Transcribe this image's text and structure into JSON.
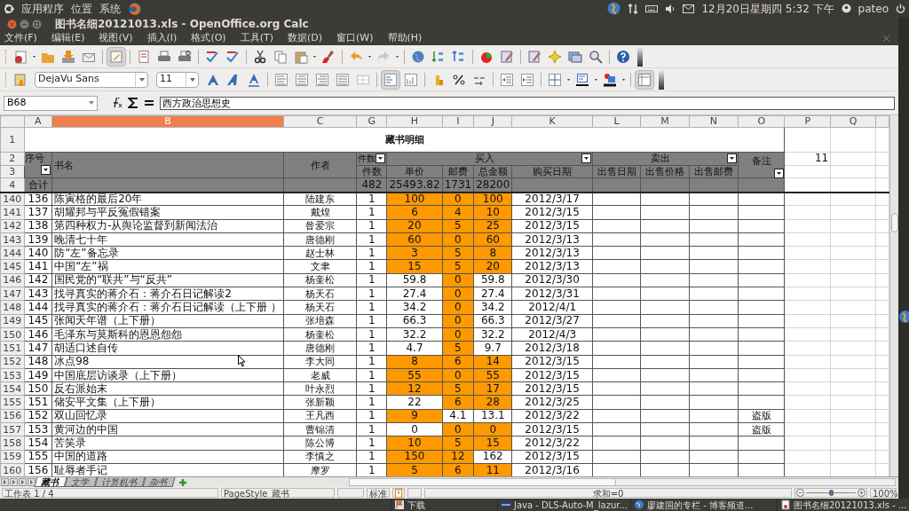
{
  "top_panel": {
    "menus": [
      "应用程序",
      "位置",
      "系统"
    ],
    "clock": "12月20日星期四 5:32 下午",
    "user": "pateo"
  },
  "window": {
    "title": "图书名细20121013.xls - OpenOffice.org Calc"
  },
  "menu": [
    "文件(F)",
    "编辑(E)",
    "视图(V)",
    "插入(I)",
    "格式(O)",
    "工具(T)",
    "数据(D)",
    "窗口(W)",
    "帮助(H)"
  ],
  "formatting": {
    "font": "DejaVu Sans",
    "size": "11"
  },
  "formula_bar": {
    "name_box": "B68",
    "formula": "西方政治思想史"
  },
  "sheet": {
    "columns": [
      {
        "label": "A",
        "selected": false
      },
      {
        "label": "B",
        "selected": true
      },
      {
        "label": "C",
        "selected": false
      },
      {
        "label": "G",
        "selected": false
      },
      {
        "label": "H",
        "selected": false
      },
      {
        "label": "I",
        "selected": false
      },
      {
        "label": "J",
        "selected": false
      },
      {
        "label": "K",
        "selected": false
      },
      {
        "label": "L",
        "selected": false
      },
      {
        "label": "M",
        "selected": false
      },
      {
        "label": "N",
        "selected": false
      },
      {
        "label": "O",
        "selected": false
      },
      {
        "label": "P",
        "selected": false
      },
      {
        "label": "Q",
        "selected": false
      }
    ],
    "header_rows": [
      "1",
      "2",
      "3",
      "4"
    ],
    "title": "藏书明细",
    "headers": {
      "no": "序号",
      "title": "书名",
      "author": "作者",
      "count_group": "件数",
      "buy": "买入",
      "sell": "卖出",
      "note": "备注",
      "count": "件数",
      "price": "单价",
      "postage": "邮费",
      "total": "总金额",
      "buy_date": "购买日期",
      "sell_date": "出售日期",
      "sell_price": "出售价格",
      "sell_postage": "出售邮费"
    },
    "totals": {
      "label": "合计",
      "count": "482",
      "price": "25493.82",
      "postage": "1731",
      "total": "28200"
    },
    "p2": "11",
    "rows": [
      {
        "row": "140",
        "no": "136",
        "title": "陈寅格的最后20年",
        "author": "陆建东",
        "count": "1",
        "price": "100",
        "postage": "0",
        "total": "100",
        "date": "2012/3/17",
        "highlight": {
          "price": true,
          "postage": true,
          "total": true
        }
      },
      {
        "row": "141",
        "no": "137",
        "title": "胡耀邦与平反冤假错案",
        "author": "戴煌",
        "count": "1",
        "price": "6",
        "postage": "4",
        "total": "10",
        "date": "2012/3/15",
        "highlight": {
          "price": true,
          "postage": true,
          "total": true
        }
      },
      {
        "row": "142",
        "no": "138",
        "title": "第四种权力-从舆论监督到新闻法治",
        "author": "昝爱宗",
        "count": "1",
        "price": "20",
        "postage": "5",
        "total": "25",
        "date": "2012/3/15",
        "highlight": {
          "price": true,
          "postage": true,
          "total": true
        }
      },
      {
        "row": "143",
        "no": "139",
        "title": "晚清七十年",
        "author": "唐德刚",
        "count": "1",
        "price": "60",
        "postage": "0",
        "total": "60",
        "date": "2012/3/13",
        "highlight": {
          "price": true,
          "postage": true,
          "total": true
        }
      },
      {
        "row": "144",
        "no": "140",
        "title": "防“左”备忘录",
        "author": "赵士林",
        "count": "1",
        "price": "3",
        "postage": "5",
        "total": "8",
        "date": "2012/3/13",
        "highlight": {
          "price": true,
          "postage": true,
          "total": true
        }
      },
      {
        "row": "145",
        "no": "141",
        "title": "中国“左”祸",
        "author": "文聿",
        "count": "1",
        "price": "15",
        "postage": "5",
        "total": "20",
        "date": "2012/3/13",
        "highlight": {
          "price": true,
          "postage": true,
          "total": true
        }
      },
      {
        "row": "146",
        "no": "142",
        "title": "国民党的“联共”与“反共”",
        "author": "杨奎松",
        "count": "1",
        "price": "59.8",
        "postage": "0",
        "total": "59.8",
        "date": "2012/3/30",
        "highlight": {
          "price": false,
          "postage": true,
          "total": false
        }
      },
      {
        "row": "147",
        "no": "143",
        "title": "找寻真实的蒋介石：蒋介石日记解读2",
        "author": "杨天石",
        "count": "1",
        "price": "27.4",
        "postage": "0",
        "total": "27.4",
        "date": "2012/3/31",
        "highlight": {
          "price": false,
          "postage": true,
          "total": false
        }
      },
      {
        "row": "148",
        "no": "144",
        "title": "找寻真实的蒋介石：蒋介石日记解读（上下册 ）",
        "author": "杨天石",
        "count": "1",
        "price": "34.2",
        "postage": "0",
        "total": "34.2",
        "date": "2012/4/1",
        "highlight": {
          "price": false,
          "postage": true,
          "total": false
        }
      },
      {
        "row": "149",
        "no": "145",
        "title": "张闻天年谱（上下册）",
        "author": "张培森",
        "count": "1",
        "price": "66.3",
        "postage": "0",
        "total": "66.3",
        "date": "2012/3/27",
        "highlight": {
          "price": false,
          "postage": true,
          "total": false
        }
      },
      {
        "row": "150",
        "no": "146",
        "title": "毛泽东与莫斯科的恩恩怨怨",
        "author": "杨奎松",
        "count": "1",
        "price": "32.2",
        "postage": "0",
        "total": "32.2",
        "date": "2012/4/3",
        "highlight": {
          "price": false,
          "postage": true,
          "total": false
        }
      },
      {
        "row": "151",
        "no": "147",
        "title": "胡适口述自传",
        "author": "唐德刚",
        "count": "1",
        "price": "4.7",
        "postage": "5",
        "total": "9.7",
        "date": "2012/3/18",
        "highlight": {
          "price": false,
          "postage": true,
          "total": false
        }
      },
      {
        "row": "152",
        "no": "148",
        "title": "冰点98",
        "author": "李大同",
        "count": "1",
        "price": "8",
        "postage": "6",
        "total": "14",
        "date": "2012/3/15",
        "highlight": {
          "price": true,
          "postage": true,
          "total": true
        }
      },
      {
        "row": "153",
        "no": "149",
        "title": "中国底层访谈录（上下册）",
        "author": "老威",
        "count": "1",
        "price": "55",
        "postage": "0",
        "total": "55",
        "date": "2012/3/15",
        "highlight": {
          "price": true,
          "postage": true,
          "total": true
        }
      },
      {
        "row": "154",
        "no": "150",
        "title": "反右派始末",
        "author": "叶永烈",
        "count": "1",
        "price": "12",
        "postage": "5",
        "total": "17",
        "date": "2012/3/15",
        "highlight": {
          "price": true,
          "postage": true,
          "total": true
        }
      },
      {
        "row": "155",
        "no": "151",
        "title": "储安平文集（上下册）",
        "author": "张新颖",
        "count": "1",
        "price": "22",
        "postage": "6",
        "total": "28",
        "date": "2012/3/25",
        "highlight": {
          "price": false,
          "postage": true,
          "total": true
        }
      },
      {
        "row": "156",
        "no": "152",
        "title": "双山回忆录",
        "author": "王凡西",
        "count": "1",
        "price": "9",
        "postage": "4.1",
        "total": "13.1",
        "date": "2012/3/22",
        "note": "盗版",
        "highlight": {
          "price": true,
          "postage": false,
          "total": false
        }
      },
      {
        "row": "157",
        "no": "153",
        "title": "黄河边的中国",
        "author": "曹锦清",
        "count": "1",
        "price": "0",
        "postage": "0",
        "total": "0",
        "date": "2012/3/15",
        "note": "盗版",
        "highlight": {
          "price": false,
          "postage": true,
          "total": true
        }
      },
      {
        "row": "158",
        "no": "154",
        "title": "苦笑录",
        "author": "陈公博",
        "count": "1",
        "price": "10",
        "postage": "5",
        "total": "15",
        "date": "2012/3/22",
        "highlight": {
          "price": true,
          "postage": true,
          "total": true
        }
      },
      {
        "row": "159",
        "no": "155",
        "title": "中国的道路",
        "author": "李慎之",
        "count": "1",
        "price": "150",
        "postage": "12",
        "total": "162",
        "date": "2012/3/15",
        "highlight": {
          "price": true,
          "postage": true,
          "total": false
        }
      },
      {
        "row": "160",
        "no": "156",
        "title": "耻辱者手记",
        "author": "摩罗",
        "count": "1",
        "price": "5",
        "postage": "6",
        "total": "11",
        "date": "2012/3/16",
        "highlight": {
          "price": true,
          "postage": true,
          "total": true
        }
      }
    ]
  },
  "sheet_tabs": [
    {
      "label": "藏书",
      "selected": true
    },
    {
      "label": "文学",
      "selected": false
    },
    {
      "label": "计算机书",
      "selected": false
    },
    {
      "label": "杂书",
      "selected": false
    }
  ],
  "status_bar": {
    "sheet": "工作表 1 / 4",
    "page_style": "PageStyle_藏书",
    "mode": "标准",
    "sum": "求和=0",
    "zoom_slider": {
      "level": 0.5
    },
    "zoom": "100%"
  },
  "taskbar": [
    "下载",
    "Java - DLS-Auto-M_lazur...",
    "廖建国的专栏 - 博客频道...",
    "图书名细20121013.xls - ..."
  ]
}
